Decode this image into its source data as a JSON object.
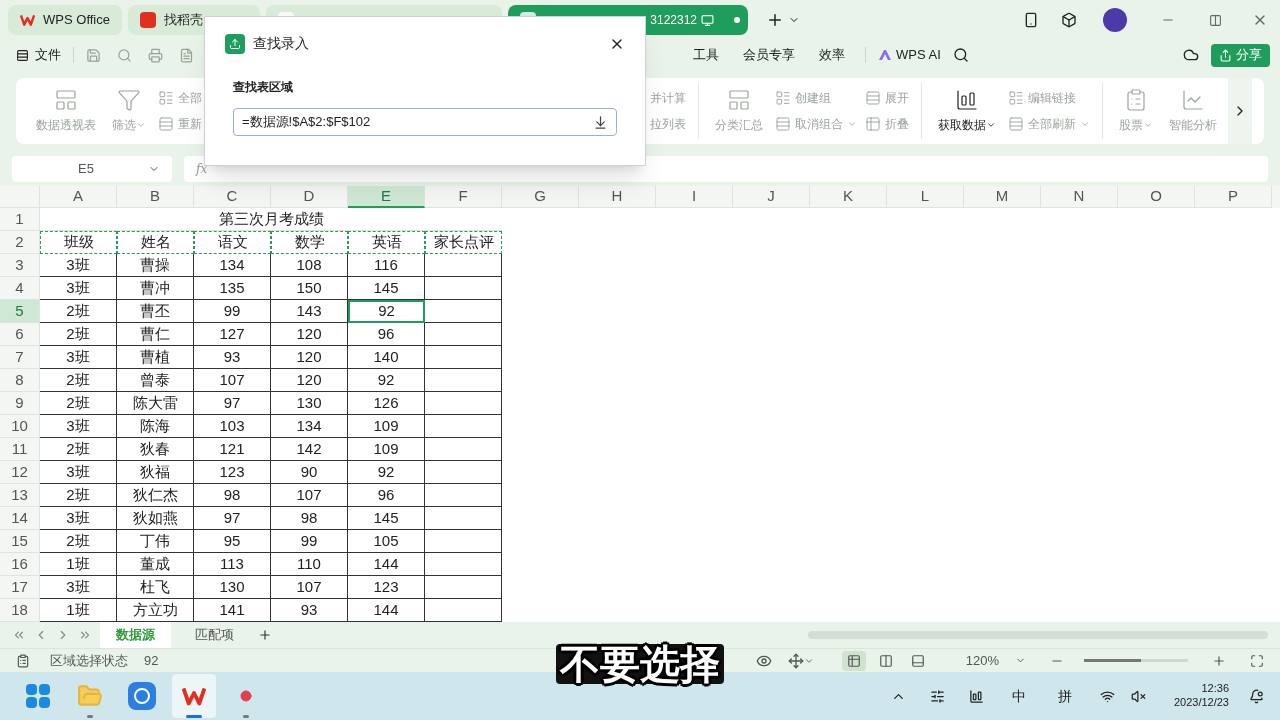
{
  "title_tabs": [
    {
      "kind": "home",
      "label": "WPS Office",
      "selected": false
    },
    {
      "kind": "doc",
      "label": "找稻壳",
      "selected": false
    },
    {
      "kind": "sheet",
      "selected": false
    },
    {
      "kind": "sheet",
      "label": "3122312",
      "selected": true
    }
  ],
  "menu": {
    "file": "文件",
    "items": [
      "工具",
      "会员专享",
      "效率"
    ],
    "ai": "WPS AI",
    "share": "分享"
  },
  "ribbon_left": [
    {
      "kind": "large",
      "label": "数据透视表",
      "dropdown": false,
      "disabled": true
    },
    {
      "kind": "large",
      "label": "筛选",
      "dropdown": true,
      "disabled": true
    },
    {
      "kind": "pair",
      "items": [
        {
          "label": "全部",
          "dropdown": false,
          "disabled": true
        },
        {
          "label": "重新",
          "dropdown": false,
          "disabled": true
        }
      ]
    }
  ],
  "ribbon_right": [
    {
      "kind": "cut",
      "items": [
        {
          "label": "并计算",
          "dropdown": false,
          "disabled": true
        },
        {
          "label": "拉列表",
          "dropdown": false,
          "disabled": true
        }
      ]
    },
    {
      "kind": "divider"
    },
    {
      "kind": "large",
      "label": "分类汇总",
      "dropdown": false,
      "disabled": true
    },
    {
      "kind": "pair",
      "items": [
        {
          "label": "创建组",
          "dropdown": false,
          "disabled": true
        },
        {
          "label": "取消组合",
          "dropdown": true,
          "disabled": true
        }
      ]
    },
    {
      "kind": "pair",
      "items": [
        {
          "label": "展开",
          "dropdown": false,
          "disabled": true
        },
        {
          "label": "折叠",
          "dropdown": false,
          "disabled": true
        }
      ]
    },
    {
      "kind": "divider"
    },
    {
      "kind": "large",
      "label": "获取数据",
      "dropdown": true,
      "disabled": false
    },
    {
      "kind": "pair",
      "items": [
        {
          "label": "编辑链接",
          "dropdown": false,
          "disabled": true
        },
        {
          "label": "全部刷新",
          "dropdown": true,
          "disabled": true
        }
      ]
    },
    {
      "kind": "divider"
    },
    {
      "kind": "large",
      "label": "股票",
      "dropdown": true,
      "disabled": true
    },
    {
      "kind": "large",
      "label": "智能分析",
      "dropdown": false,
      "disabled": true
    }
  ],
  "name_box": "E5",
  "function_label": "fx",
  "columns": [
    {
      "label": "A",
      "selected": false
    },
    {
      "label": "B",
      "selected": false
    },
    {
      "label": "C",
      "selected": false
    },
    {
      "label": "D",
      "selected": false
    },
    {
      "label": "E",
      "selected": true
    },
    {
      "label": "F",
      "selected": false
    },
    {
      "label": "G",
      "selected": false
    },
    {
      "label": "H",
      "selected": false
    },
    {
      "label": "I",
      "selected": false
    },
    {
      "label": "J",
      "selected": false
    },
    {
      "label": "K",
      "selected": false
    },
    {
      "label": "L",
      "selected": false
    },
    {
      "label": "M",
      "selected": false
    },
    {
      "label": "N",
      "selected": false
    },
    {
      "label": "O",
      "selected": false
    },
    {
      "label": "P",
      "selected": false
    }
  ],
  "sheet_title": {
    "row": "1",
    "text": "第三次月考成绩"
  },
  "rows": [
    {
      "number": "2",
      "selected": false,
      "cells": [
        "班级",
        "姓名",
        "语文",
        "数学",
        "英语",
        "家长点评"
      ]
    },
    {
      "number": "3",
      "selected": false,
      "cells": [
        "3班",
        "曹操",
        "134",
        "108",
        "116",
        ""
      ]
    },
    {
      "number": "4",
      "selected": false,
      "cells": [
        "3班",
        "曹冲",
        "135",
        "150",
        "145",
        ""
      ]
    },
    {
      "number": "5",
      "selected": true,
      "cells": [
        "2班",
        "曹丕",
        "99",
        "143",
        "92",
        ""
      ]
    },
    {
      "number": "6",
      "selected": false,
      "cells": [
        "2班",
        "曹仁",
        "127",
        "120",
        "96",
        ""
      ]
    },
    {
      "number": "7",
      "selected": false,
      "cells": [
        "3班",
        "曹植",
        "93",
        "120",
        "140",
        ""
      ]
    },
    {
      "number": "8",
      "selected": false,
      "cells": [
        "2班",
        "曾泰",
        "107",
        "120",
        "92",
        ""
      ]
    },
    {
      "number": "9",
      "selected": false,
      "cells": [
        "2班",
        "陈大雷",
        "97",
        "130",
        "126",
        ""
      ]
    },
    {
      "number": "10",
      "selected": false,
      "cells": [
        "3班",
        "陈海",
        "103",
        "134",
        "109",
        ""
      ]
    },
    {
      "number": "11",
      "selected": false,
      "cells": [
        "2班",
        "狄春",
        "121",
        "142",
        "109",
        ""
      ]
    },
    {
      "number": "12",
      "selected": false,
      "cells": [
        "3班",
        "狄福",
        "123",
        "90",
        "92",
        ""
      ]
    },
    {
      "number": "13",
      "selected": false,
      "cells": [
        "2班",
        "狄仁杰",
        "98",
        "107",
        "96",
        ""
      ]
    },
    {
      "number": "14",
      "selected": false,
      "cells": [
        "3班",
        "狄如燕",
        "97",
        "98",
        "145",
        ""
      ]
    },
    {
      "number": "15",
      "selected": false,
      "cells": [
        "2班",
        "丁伟",
        "95",
        "99",
        "105",
        ""
      ]
    },
    {
      "number": "16",
      "selected": false,
      "cells": [
        "1班",
        "董成",
        "113",
        "110",
        "144",
        ""
      ]
    },
    {
      "number": "17",
      "selected": false,
      "cells": [
        "3班",
        "杜飞",
        "130",
        "107",
        "123",
        ""
      ]
    },
    {
      "number": "18",
      "selected": false,
      "cells": [
        "1班",
        "方立功",
        "141",
        "93",
        "144",
        ""
      ]
    }
  ],
  "sheets": [
    {
      "label": "数据源",
      "selected": true
    },
    {
      "label": "匹配项",
      "selected": false
    }
  ],
  "status": {
    "mode": "区域选择状态",
    "value": "92",
    "zoom": "120%",
    "zoom_slider": {
      "level": 0.55
    },
    "views": [
      {
        "kind": "normal",
        "selected": true
      },
      {
        "kind": "split",
        "selected": false
      },
      {
        "kind": "page",
        "selected": false
      }
    ]
  },
  "dialog": {
    "title": "查找录入",
    "field_label": "查找表区域",
    "value": "=数据源!$A$2:$F$102"
  },
  "caption": "不要选择",
  "taskbar": {
    "apps": [
      {
        "kind": "start",
        "running": false,
        "selected": false
      },
      {
        "kind": "files",
        "running": true,
        "selected": false
      },
      {
        "kind": "k",
        "running": false,
        "selected": false
      },
      {
        "kind": "wps",
        "running": true,
        "selected": true
      },
      {
        "kind": "record",
        "running": true,
        "selected": false
      }
    ],
    "ime": [
      "中",
      "拼"
    ],
    "time": "12:36",
    "date": "2023/12/23"
  }
}
